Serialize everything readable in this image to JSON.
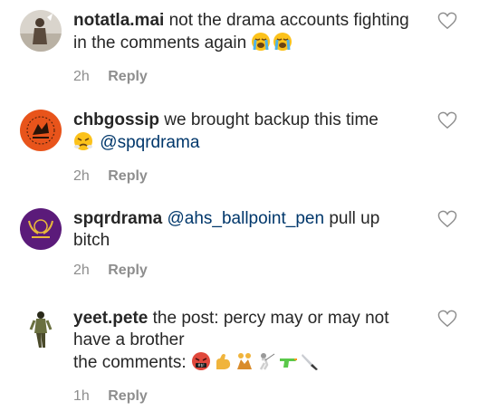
{
  "comments": [
    {
      "username": "notatla.mai",
      "text": "not the drama accounts fighting in the comments again",
      "emojis": [
        "loudly-crying-face",
        "loudly-crying-face"
      ],
      "time": "2h",
      "reply_label": "Reply"
    },
    {
      "username": "chbgossip",
      "text_before": "we brought backup this time",
      "emojis": [
        "face-with-steam"
      ],
      "mention": "@spqrdrama",
      "time": "2h",
      "reply_label": "Reply"
    },
    {
      "username": "spqrdrama",
      "mention": "@ahs_ballpoint_pen",
      "text_after": "pull up bitch",
      "time": "2h",
      "reply_label": "Reply"
    },
    {
      "username": "yeet.pete",
      "line1": "the post: percy may or may not have a brother",
      "line2": "the comments:",
      "emojis": [
        "face-with-symbols",
        "flexed-biceps",
        "people-wrestling",
        "person-fencing",
        "water-pistol",
        "kitchen-knife"
      ],
      "time": "1h",
      "reply_label": "Reply"
    }
  ],
  "colors": {
    "username": "#262626",
    "mention": "#00376b",
    "meta": "#8e8e8e"
  }
}
